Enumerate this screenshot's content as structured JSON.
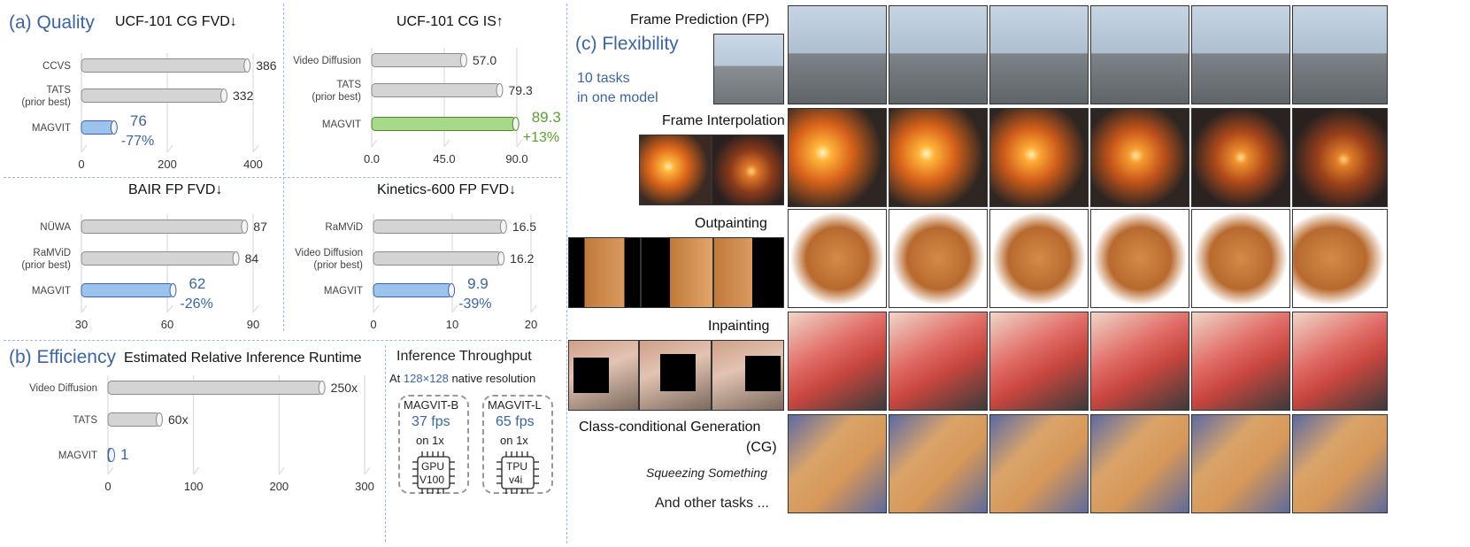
{
  "quality": {
    "label": "(a) Quality",
    "charts": [
      {
        "id": "ucf-fvd",
        "title": "UCF-101 CG FVD↓",
        "categories": [
          [
            "CCVS"
          ],
          [
            "TATS",
            "(prior best)"
          ],
          [
            "MAGVIT"
          ]
        ],
        "values": [
          386,
          332,
          76
        ],
        "labels": [
          "386",
          "332",
          "76"
        ],
        "delta": "-77%",
        "xlim": [
          0,
          400
        ],
        "ticks": [
          "0",
          "200",
          "400"
        ],
        "tickvals": [
          0,
          200,
          400
        ]
      },
      {
        "id": "ucf-is",
        "title": "UCF-101 CG IS↑",
        "categories": [
          [
            "Video Diffusion"
          ],
          [
            "TATS",
            "(prior best)"
          ],
          [
            "MAGVIT"
          ]
        ],
        "values": [
          57.0,
          79.3,
          89.3
        ],
        "labels": [
          "57.0",
          "79.3",
          "89.3"
        ],
        "delta": "+13%",
        "xlim": [
          0,
          90
        ],
        "ticks": [
          "0.0",
          "45.0",
          "90.0"
        ],
        "tickvals": [
          0,
          45,
          90
        ]
      },
      {
        "id": "bair-fvd",
        "title": "BAIR FP FVD↓",
        "categories": [
          [
            "NÜWA"
          ],
          [
            "RaMViD",
            "(prior best)"
          ],
          [
            "MAGVIT"
          ]
        ],
        "values": [
          87,
          84,
          62
        ],
        "labels": [
          "87",
          "84",
          "62"
        ],
        "delta": "-26%",
        "xlim": [
          30,
          90
        ],
        "ticks": [
          "30",
          "60",
          "90"
        ],
        "tickvals": [
          30,
          60,
          90
        ]
      },
      {
        "id": "k600-fvd",
        "title": "Kinetics-600 FP FVD↓",
        "categories": [
          [
            "RaMViD"
          ],
          [
            "Video Diffusion",
            "(prior best)"
          ],
          [
            "MAGVIT"
          ]
        ],
        "values": [
          16.5,
          16.2,
          9.9
        ],
        "labels": [
          "16.5",
          "16.2",
          "9.9"
        ],
        "delta": "-39%",
        "xlim": [
          0,
          20
        ],
        "ticks": [
          "0",
          "10",
          "20"
        ],
        "tickvals": [
          0,
          10,
          20
        ]
      }
    ]
  },
  "efficiency": {
    "label": "(b) Efficiency",
    "chart": {
      "id": "runtime",
      "title": "Estimated Relative Inference Runtime",
      "categories": [
        [
          "Video Diffusion"
        ],
        [
          "TATS"
        ],
        [
          "MAGVIT"
        ]
      ],
      "values": [
        250,
        60,
        1
      ],
      "labels": [
        "250x",
        "60x",
        "1"
      ],
      "xlim": [
        0,
        300
      ],
      "ticks": [
        "0",
        "100",
        "200",
        "300"
      ],
      "tickvals": [
        0,
        100,
        200,
        300
      ]
    },
    "throughput": {
      "title": "Inference Throughput",
      "subtitle_pre": "At ",
      "subtitle_res": "128×128",
      "subtitle_post": " native resolution",
      "devices": [
        {
          "model": "MAGVIT-B",
          "fps": "37 fps",
          "on": "on 1x",
          "chip1": "GPU",
          "chip2": "V100"
        },
        {
          "model": "MAGVIT-L",
          "fps": "65 fps",
          "on": "on 1x",
          "chip1": "TPU",
          "chip2": "v4i"
        }
      ]
    }
  },
  "flexibility": {
    "label": "(c) Flexibility",
    "tasks_count": "10 tasks",
    "tasks_sub": "in one model",
    "tasks": [
      "Frame Prediction (FP)",
      "Frame Interpolation",
      "Outpainting",
      "Inpainting",
      "Class-conditional Generation",
      "(CG)"
    ],
    "cg_class": "Squeezing Something",
    "other": "And other tasks ..."
  },
  "chart_data": [
    {
      "type": "bar",
      "title": "UCF-101 CG FVD↓",
      "categories": [
        "CCVS",
        "TATS (prior best)",
        "MAGVIT"
      ],
      "values": [
        386,
        332,
        76
      ],
      "xlim": [
        0,
        400
      ]
    },
    {
      "type": "bar",
      "title": "UCF-101 CG IS↑",
      "categories": [
        "Video Diffusion",
        "TATS (prior best)",
        "MAGVIT"
      ],
      "values": [
        57.0,
        79.3,
        89.3
      ],
      "xlim": [
        0,
        90
      ]
    },
    {
      "type": "bar",
      "title": "BAIR FP FVD↓",
      "categories": [
        "NÜWA",
        "RaMViD (prior best)",
        "MAGVIT"
      ],
      "values": [
        87,
        84,
        62
      ],
      "xlim": [
        30,
        90
      ]
    },
    {
      "type": "bar",
      "title": "Kinetics-600 FP FVD↓",
      "categories": [
        "RaMViD",
        "Video Diffusion (prior best)",
        "MAGVIT"
      ],
      "values": [
        16.5,
        16.2,
        9.9
      ],
      "xlim": [
        0,
        20
      ]
    },
    {
      "type": "bar",
      "title": "Estimated Relative Inference Runtime",
      "categories": [
        "Video Diffusion",
        "TATS",
        "MAGVIT"
      ],
      "values": [
        250,
        60,
        1
      ],
      "xlim": [
        0,
        300
      ]
    }
  ],
  "colors": {
    "accent": "#3b64a8",
    "green": "#5aa02c",
    "gray_bar": "#d4d4d4",
    "blue_bar": "#9cc3ec",
    "green_bar": "#a8d98a"
  }
}
